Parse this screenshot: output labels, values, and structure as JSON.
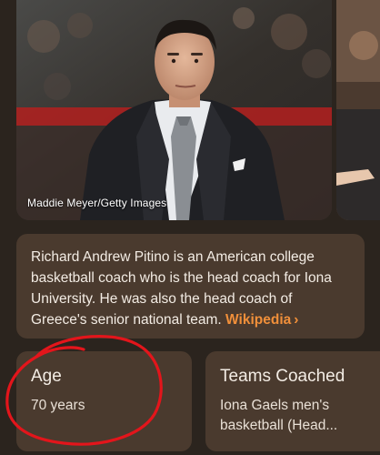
{
  "carousel": {
    "photo_credit": "Maddie Meyer/Getty Images"
  },
  "description": {
    "text": "Richard Andrew Pitino is an American college basketball coach who is the head coach for Iona University. He was also the head coach of Greece's senior national team.",
    "link_label": "Wikipedia",
    "link_chevron": "›"
  },
  "facts": {
    "age": {
      "title": "Age",
      "value": "70 years"
    },
    "teams_coached": {
      "title": "Teams Coached",
      "value": "Iona Gaels men's basketball (Head..."
    }
  },
  "colors": {
    "background": "#2b241e",
    "card": "#4a3a2e",
    "link_accent": "#f08f3a",
    "annotation": "#e3151b"
  },
  "icons": [
    "chevron-right-icon"
  ]
}
